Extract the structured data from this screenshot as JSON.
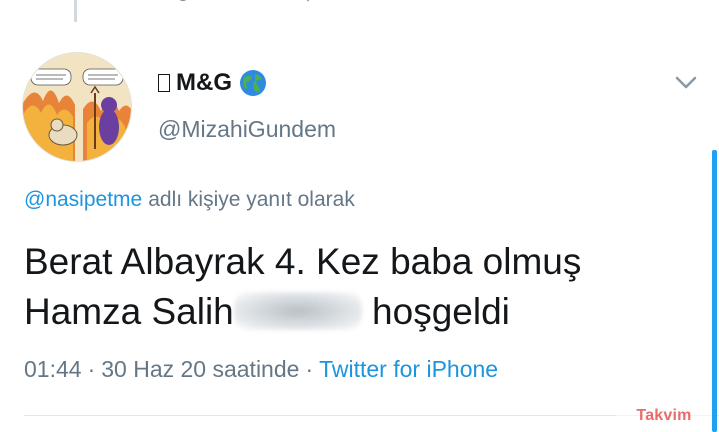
{
  "tweet": {
    "display_name": "M&G",
    "handle": "@MizahiGundem",
    "reply_to": {
      "mention": "@nasipetme",
      "suffix": "adlı kişiye yanıt olarak"
    },
    "text_line_1": "Berat Albayrak 4. Kez baba olmuş",
    "text_line_2_start": "Hamza Salih",
    "text_line_2_end": "hoşgeldi",
    "time": "01:44",
    "date": "30 Haz 20 saatinde",
    "separator": "·",
    "source": "Twitter for iPhone"
  },
  "icons": {
    "avatar": "cartoon-avatar",
    "globe": "globe-icon",
    "chevron": "chevron-down-icon",
    "name_prefix": "unsupported-glyph-box"
  },
  "colors": {
    "accent": "#1b95e0",
    "secondary_text": "#657786",
    "primary_text": "#14171a",
    "scrollbar": "#1da1f2"
  },
  "watermark": {
    "text": "Takvim"
  }
}
